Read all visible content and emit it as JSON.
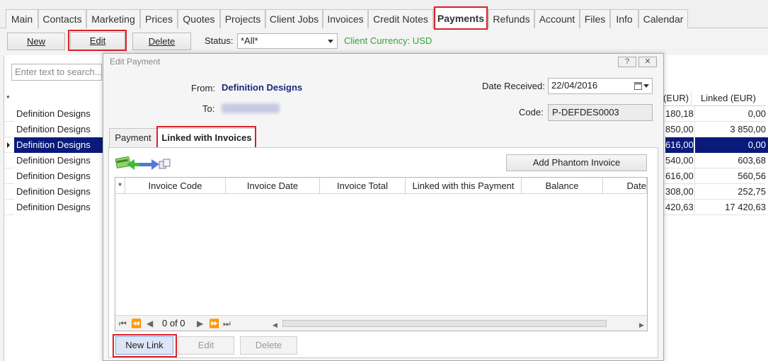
{
  "tabs": [
    "Main",
    "Contacts",
    "Marketing",
    "Prices",
    "Quotes",
    "Projects",
    "Client Jobs",
    "Invoices",
    "Credit Notes",
    "Payments",
    "Refunds",
    "Account",
    "Files",
    "Info",
    "Calendar"
  ],
  "active_tab": "Payments",
  "toolbar": {
    "new_label": "New",
    "edit_label": "Edit",
    "delete_label": "Delete",
    "status_label": "Status:",
    "status_value": "*All*",
    "currency_label": "Client Currency: USD"
  },
  "colors": {
    "currency": "#3aa13a",
    "highlight_border": "#d9202a",
    "selected_row": "#0a1a7a",
    "from_value": "#1a2a7a"
  },
  "search": {
    "placeholder": "Enter text to search..."
  },
  "grid": {
    "indicator": "*",
    "headers": {
      "eur": "(EUR)",
      "linked": "Linked (EUR)"
    },
    "rows": [
      {
        "name": "Definition Designs",
        "eur": "180,18",
        "linked": "0,00"
      },
      {
        "name": "Definition Designs",
        "eur": "850,00",
        "linked": "3 850,00"
      },
      {
        "name": "Definition Designs",
        "eur": "616,00",
        "linked": "0,00"
      },
      {
        "name": "Definition Designs",
        "eur": "540,00",
        "linked": "603,68"
      },
      {
        "name": "Definition Designs",
        "eur": "616,00",
        "linked": "560,56"
      },
      {
        "name": "Definition Designs",
        "eur": "308,00",
        "linked": "252,75"
      },
      {
        "name": "Definition Designs",
        "eur": "420,63",
        "linked": "17 420,63"
      }
    ]
  },
  "dialog": {
    "title": "Edit Payment",
    "help_icon": "?",
    "close_icon": "✕",
    "from_label": "From:",
    "from_value": "Definition Designs",
    "to_label": "To:",
    "date_label": "Date Received:",
    "date_value": "22/04/2016",
    "code_label": "Code:",
    "code_value": "P-DEFDES0003",
    "tabs": [
      "Payment",
      "Linked with Invoices"
    ],
    "add_phantom_label": "Add Phantom Invoice",
    "inner_headers": [
      "*",
      "Invoice Code",
      "Invoice Date",
      "Invoice Total",
      "Linked with this Payment",
      "Balance",
      "Date"
    ],
    "pager": "0 of 0",
    "new_link_label": "New Link",
    "edit_label": "Edit",
    "delete_label": "Delete"
  }
}
